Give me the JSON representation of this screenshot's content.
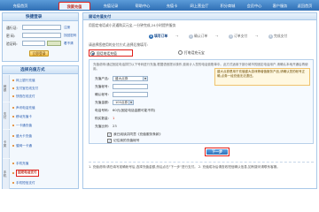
{
  "nav": {
    "tabs": [
      "充值首页",
      "我要充值",
      "充值记录",
      "帮助中心",
      "充值卡",
      "网上营业厅",
      "积分商城",
      "会员中心",
      "客户服务",
      "返回首页"
    ],
    "active_index": 1
  },
  "login": {
    "title": "快捷登录",
    "username_label": "通行证:",
    "password_label": "密   码:",
    "code_label": "验证码:",
    "register_link": "注册",
    "forgot_link": "找回密码",
    "change_code_link": "看不清",
    "login_button": "立即登录"
  },
  "methods": {
    "title": "选择充值方式",
    "groups": [
      "网银",
      "支付",
      "卡类",
      "手机"
    ],
    "items": [
      "网上银行充值",
      "支付宝在线支付",
      "快钱在线支付",
      "声讯电话充值",
      "移动充值卡",
      "一卡通充值",
      "盛大卡充值",
      "骏网一卡通",
      "手机充值",
      "固定电话支付",
      "手机短信支付"
    ],
    "selected_index": 9
  },
  "main": {
    "header": "固话充值支付",
    "intro": "用固定电话或小灵通购买元宝,一分钟完成,24小时提供服务",
    "steps": [
      {
        "num": "1",
        "label": "填写订单"
      },
      {
        "num": "2",
        "label": "确认订单"
      },
      {
        "num": "3",
        "label": "订单支付"
      },
      {
        "num": "4",
        "label": "完成支付"
      }
    ],
    "hint": "请选择您使用的支付方式,选择后按填写:",
    "options": [
      "固话电话充值",
      "打电话充元宝"
    ],
    "selected_option": 0,
    "notice": "充值说明:通过固定电话拨打以下号码进行充值,根据语音提示操作,费用计入您的电话费账单中。此方式适用于部分城市的固定电话用户,请确认本地开通后再使用。",
    "fields": {
      "product_label": "充值产品:",
      "product_value": "盛大点券",
      "account_label": "充值帐号:",
      "confirm_label": "确认帐号:",
      "amount_label": "充值金额:",
      "amount_value": "100点券",
      "phone_label": "电话号码:",
      "phone_value": "60元(固定电话金额可能不同)",
      "count_label": "购买数量:",
      "count_value": "1",
      "rate_label": "充值比例:",
      "rate_value": "23"
    },
    "tip": "盛大点券是用于充值盛大游戏等增值服务产品,请确认您的帐号正确,点券一经充值无法退还。",
    "agree_text": "我已阅读并同意《充值服务条款》",
    "remember_text": "记住我的充值帐号",
    "next_button": "下一步",
    "footer": "1. 充值说明:请在填写准确帐号后,选择充值金额,然后点击\"下一步\"进行支付。 2. 充值成功后请查收短信确认信息,如有疑问请联系客服。"
  }
}
